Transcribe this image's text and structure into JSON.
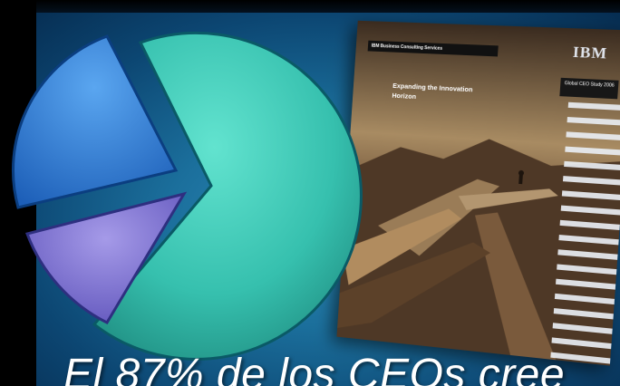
{
  "slide": {
    "caption": "El 87% de los CEOs cree",
    "colors": {
      "pie_teal": "#36c9b6",
      "pie_blue": "#2f86e0",
      "pie_violet": "#7f74d4",
      "background": "#1b6f9c"
    }
  },
  "cover": {
    "header": "IBM Business Consulting Services",
    "title": "Expanding the Innovation Horizon",
    "logo": "IBM",
    "study": "Global CEO Study 2006"
  }
}
